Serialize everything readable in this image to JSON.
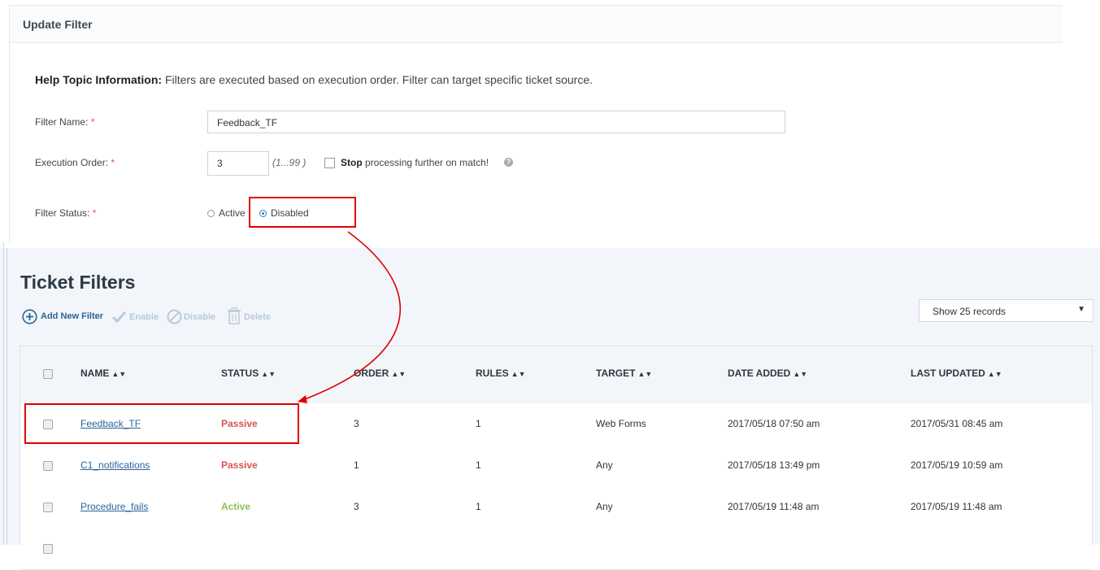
{
  "update_filter": {
    "title": "Update Filter",
    "help_bold": "Help Topic Information:",
    "help_text": " Filters are executed based on execution order. Filter can target specific ticket source.",
    "filter_name_label": "Filter Name:",
    "filter_name_value": "Feedback_TF",
    "execution_order_label": "Execution Order:",
    "execution_order_value": "3",
    "range_hint": "(1...99 )",
    "stop_bold": "Stop",
    "stop_text": " processing further on match!",
    "help_icon": "question-circle-icon",
    "filter_status_label": "Filter Status:",
    "required_mark": "*",
    "status_options": [
      "Active",
      "Disabled"
    ],
    "status_selected": "Disabled"
  },
  "ticket_filters": {
    "title": "Ticket Filters",
    "toolbar": {
      "add_label": "Add New Filter",
      "enable_label": "Enable",
      "disable_label": "Disable",
      "delete_label": "Delete"
    },
    "records_select": "Show 25 records",
    "columns": [
      "NAME",
      "STATUS",
      "ORDER",
      "RULES",
      "TARGET",
      "DATE ADDED",
      "LAST UPDATED"
    ],
    "rows": [
      {
        "name": "Feedback_TF",
        "status": "Passive",
        "order": "3",
        "rules": "1",
        "target": "Web Forms",
        "date_added": "2017/05/18 07:50 am",
        "last_updated": "2017/05/31 08:45 am"
      },
      {
        "name": "C1_notifications",
        "status": "Passive",
        "order": "1",
        "rules": "1",
        "target": "Any",
        "date_added": "2017/05/18 13:49 pm",
        "last_updated": "2017/05/19 10:59 am"
      },
      {
        "name": "Procedure_fails",
        "status": "Active",
        "order": "3",
        "rules": "1",
        "target": "Any",
        "date_added": "2017/05/19 11:48 am",
        "last_updated": "2017/05/19 11:48 am"
      }
    ]
  },
  "colors": {
    "accent": "#2a6496",
    "passive": "#d9534f",
    "active": "#8cc152",
    "highlight_box": "#e00000"
  }
}
